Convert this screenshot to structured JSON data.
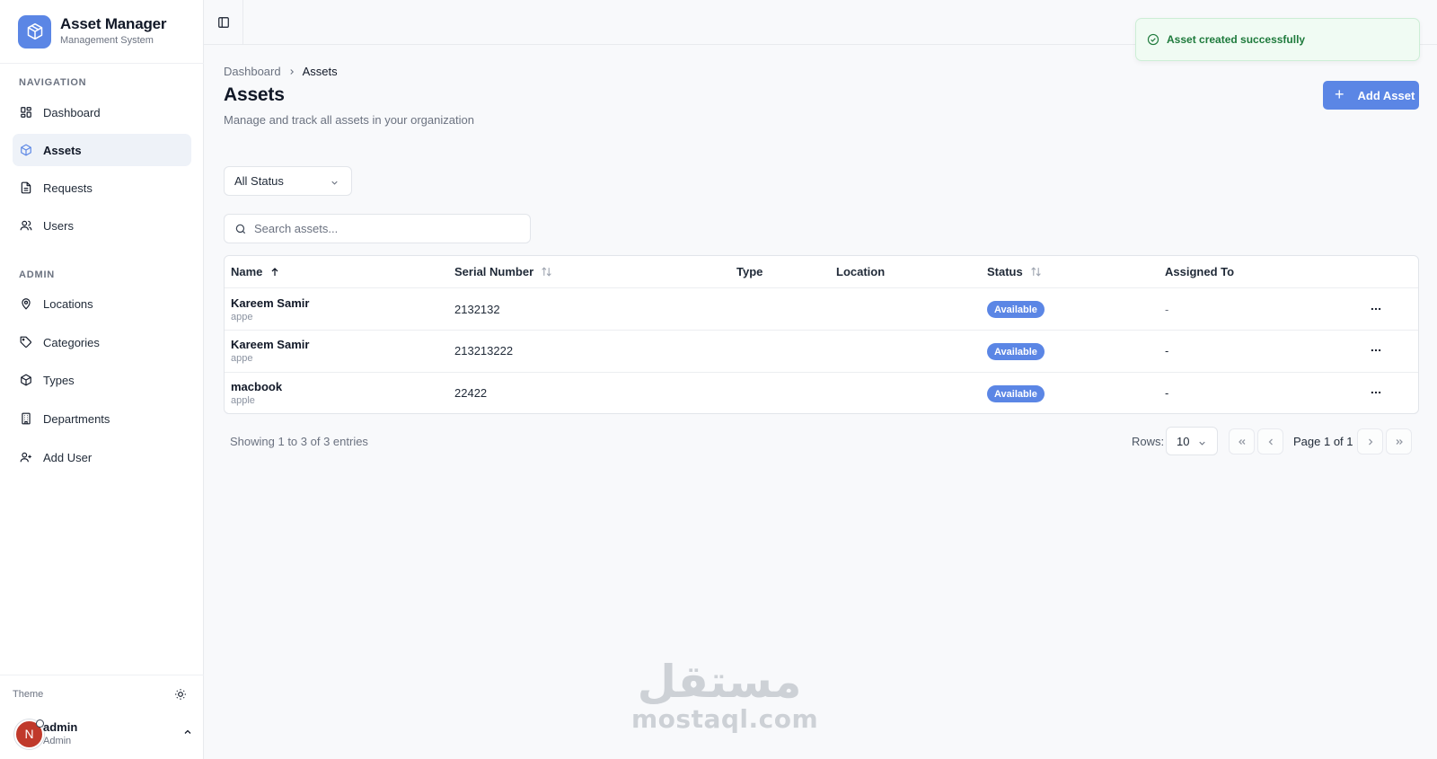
{
  "brand": {
    "title": "Asset Manager",
    "subtitle": "Management System"
  },
  "sidebar": {
    "navigation_label": "NAVIGATION",
    "navigation": [
      {
        "label": "Dashboard",
        "icon": "dashboard-grid-icon"
      },
      {
        "label": "Assets",
        "icon": "package-icon",
        "active": true
      },
      {
        "label": "Requests",
        "icon": "document-icon"
      },
      {
        "label": "Users",
        "icon": "users-icon"
      }
    ],
    "admin_label": "ADMIN",
    "admin": [
      {
        "label": "Locations",
        "icon": "map-pin-icon"
      },
      {
        "label": "Categories",
        "icon": "tag-icon"
      },
      {
        "label": "Types",
        "icon": "package-icon"
      },
      {
        "label": "Departments",
        "icon": "building-icon"
      },
      {
        "label": "Add User",
        "icon": "user-plus-icon"
      }
    ],
    "theme_label": "Theme",
    "user": {
      "initial": "N",
      "name": "admin",
      "role": "Admin"
    }
  },
  "toast": {
    "message": "Asset created successfully",
    "color": "#1e7a3c"
  },
  "breadcrumb": {
    "parent": "Dashboard",
    "current": "Assets"
  },
  "page": {
    "title": "Assets",
    "subtitle": "Manage and track all assets in your organization",
    "add_button": "Add Asset"
  },
  "filters": {
    "status_selected": "All Status",
    "search_placeholder": "Search assets..."
  },
  "table": {
    "columns": {
      "name": "Name",
      "serial": "Serial Number",
      "type": "Type",
      "location": "Location",
      "status": "Status",
      "assigned": "Assigned To"
    },
    "rows": [
      {
        "name": "Kareem Samir",
        "sub": "appe",
        "serial": "2132132",
        "type": "",
        "location": "",
        "status": "Available",
        "assigned": "-"
      },
      {
        "name": "Kareem Samir",
        "sub": "appe",
        "serial": "213213222",
        "type": "",
        "location": "",
        "status": "Available",
        "assigned": "-"
      },
      {
        "name": "macbook",
        "sub": "apple",
        "serial": "22422",
        "type": "",
        "location": "",
        "status": "Available",
        "assigned": "-"
      }
    ]
  },
  "pagination": {
    "showing": "Showing 1 to 3 of 3 entries",
    "rows_label": "Rows:",
    "rows_value": "10",
    "page_info": "Page 1 of 1"
  },
  "watermark": {
    "arabic": "مستقل",
    "latin": "mostaql.com"
  },
  "colors": {
    "accent": "#5b86e5",
    "avatar": "#c0392b",
    "toast_bg": "#f0fbf3"
  }
}
